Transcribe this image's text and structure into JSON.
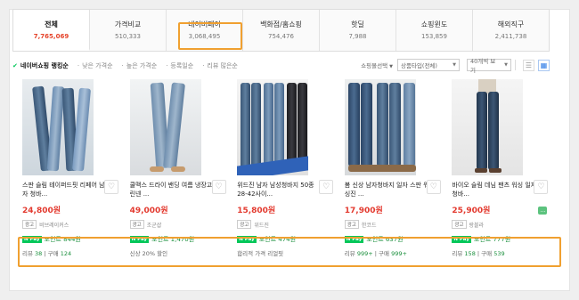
{
  "tabs": [
    {
      "name": "전체",
      "count": "7,765,069"
    },
    {
      "name": "가격비교",
      "count": "510,333"
    },
    {
      "name": "네이버페이",
      "count": "3,068,495"
    },
    {
      "name": "백화점/홈쇼핑",
      "count": "754,476"
    },
    {
      "name": "핫딜",
      "count": "7,988"
    },
    {
      "name": "쇼핑윈도",
      "count": "153,859"
    },
    {
      "name": "해외직구",
      "count": "2,411,738"
    }
  ],
  "sort": {
    "items": [
      "네이버쇼핑 랭킹순",
      "낮은 가격순",
      "높은 가격순",
      "등록일순",
      "리뷰 많은순"
    ],
    "mall_label": "쇼핑몰선택",
    "type_select": "상품타입(전체)",
    "count_select": "40개씩 보기"
  },
  "products": [
    {
      "title": "스판 슬림 테이퍼드핏 리페어 남자 청바...",
      "price": "24,800원",
      "seller": "비브레이커스",
      "point": "포인트 844원",
      "review_label": "리뷰",
      "review_count": "38",
      "order_label": "구매",
      "order_count": "124"
    },
    {
      "title": "쿨맥스 드라이 밴딩 여름 냉장고 린넨 ...",
      "price": "49,000원",
      "seller": "조군샵",
      "point": "포인트 1,470원",
      "note": "신상 20% 할인"
    },
    {
      "title": "위드진 남자 남성청바지 50종 28-42사이...",
      "price": "15,800원",
      "seller": "위드진",
      "point": "포인트 474원",
      "note": "합리적 가격 리얼핏"
    },
    {
      "title": "봄 신상 남자청바지 일자 스판 워싱진 ...",
      "price": "17,900원",
      "seller": "한코드",
      "point": "포인트 637원",
      "review_label": "리뷰",
      "review_count": "999+",
      "order_label": "구매",
      "order_count": "999+"
    },
    {
      "title": "바이오 슬림 데님 팬츠 워싱 일자 청바...",
      "price": "25,900원",
      "seller": "랑블라",
      "point": "포인트 777원",
      "review_label": "리뷰",
      "review_count": "158",
      "order_label": "구매",
      "order_count": "539"
    }
  ],
  "labels": {
    "ad": "광고",
    "npay": "N Pay",
    "heart": "♡"
  },
  "colors": {
    "accent": "#03c75a",
    "price": "#e33a2f",
    "highlight": "#f0a030",
    "active_count": "#e5432a"
  }
}
